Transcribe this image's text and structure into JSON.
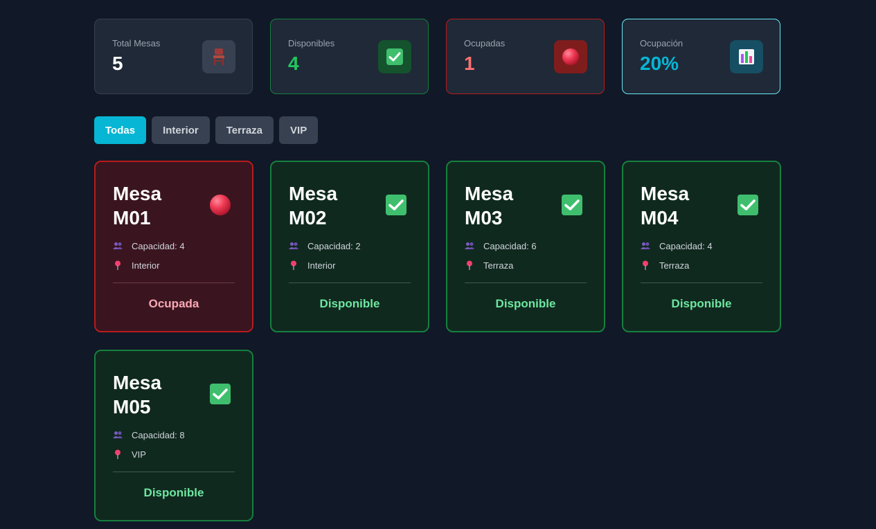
{
  "stats": [
    {
      "label": "Total Mesas",
      "value": "5",
      "variant": "gray",
      "icon": "chair-icon"
    },
    {
      "label": "Disponibles",
      "value": "4",
      "variant": "green",
      "icon": "check-icon"
    },
    {
      "label": "Ocupadas",
      "value": "1",
      "variant": "red",
      "icon": "red-circle-icon"
    },
    {
      "label": "Ocupación",
      "value": "20%",
      "variant": "cyan",
      "icon": "bar-chart-icon"
    }
  ],
  "filters": [
    "Todas",
    "Interior",
    "Terraza",
    "VIP"
  ],
  "active_filter": "Todas",
  "tables": [
    {
      "title_line1": "Mesa",
      "title_line2": "M01",
      "capacity": "Capacidad: 4",
      "zone": "Interior",
      "state": "Ocupada",
      "status": "occupied"
    },
    {
      "title_line1": "Mesa",
      "title_line2": "M02",
      "capacity": "Capacidad: 2",
      "zone": "Interior",
      "state": "Disponible",
      "status": "available"
    },
    {
      "title_line1": "Mesa",
      "title_line2": "M03",
      "capacity": "Capacidad: 6",
      "zone": "Terraza",
      "state": "Disponible",
      "status": "available"
    },
    {
      "title_line1": "Mesa",
      "title_line2": "M04",
      "capacity": "Capacidad: 4",
      "zone": "Terraza",
      "state": "Disponible",
      "status": "available"
    },
    {
      "title_line1": "Mesa",
      "title_line2": "M05",
      "capacity": "Capacidad: 8",
      "zone": "VIP",
      "state": "Disponible",
      "status": "available"
    }
  ],
  "colors": {
    "accent": "#06b6d4",
    "available": "#22c55e",
    "occupied": "#ef4444",
    "background": "#111827"
  }
}
